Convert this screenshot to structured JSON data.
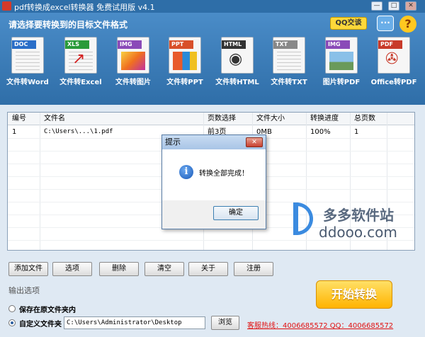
{
  "window": {
    "title": "pdf转换成excel转换器 免费试用版 v4.1",
    "controls": [
      "—",
      "□",
      "✕"
    ]
  },
  "header": {
    "prompt": "请选择要转换到的目标文件格式",
    "qq_label": "QQ交谈",
    "chat_label": "···",
    "help_label": "?"
  },
  "formats": [
    {
      "tag": "DOC",
      "label": "文件转Word",
      "color": "#2a6ec8"
    },
    {
      "tag": "XLS",
      "label": "文件转Excel",
      "color": "#2a9a3a"
    },
    {
      "tag": "IMG",
      "label": "文件转图片",
      "color": "#8a4ab8"
    },
    {
      "tag": "PPT",
      "label": "文件转PPT",
      "color": "#d8502a"
    },
    {
      "tag": "HTML",
      "label": "文件转HTML",
      "color": "#333333"
    },
    {
      "tag": "TXT",
      "label": "文件转TXT",
      "color": "#888888"
    },
    {
      "tag": "IMG",
      "label": "图片转PDF",
      "color": "#8a4ab8"
    },
    {
      "tag": "PDF",
      "label": "Office转PDF",
      "color": "#c83a2a"
    }
  ],
  "table": {
    "columns": [
      "编号",
      "文件名",
      "页数选择",
      "文件大小",
      "转换进度",
      "总页数"
    ],
    "rows": [
      [
        "1",
        "C:\\Users\\...\\1.pdf",
        "前3页",
        "0MB",
        "100%",
        "1"
      ]
    ]
  },
  "buttons": [
    "添加文件",
    "选项",
    "删除",
    "清空",
    "关于",
    "注册"
  ],
  "output": {
    "label": "输出选项",
    "option_original": "保存在原文件夹内",
    "option_custom": "自定义文件夹",
    "path": "C:\\Users\\Administrator\\Desktop",
    "browse": "浏览"
  },
  "start_label": "开始转换",
  "hotline": "客服热线：4006685572 QQ：4006685572",
  "dialog": {
    "title": "提示",
    "close": "✕",
    "message": "转换全部完成！",
    "ok": "确定"
  },
  "watermark": {
    "cn": "多多软件站",
    "en": "ddooo.com"
  }
}
